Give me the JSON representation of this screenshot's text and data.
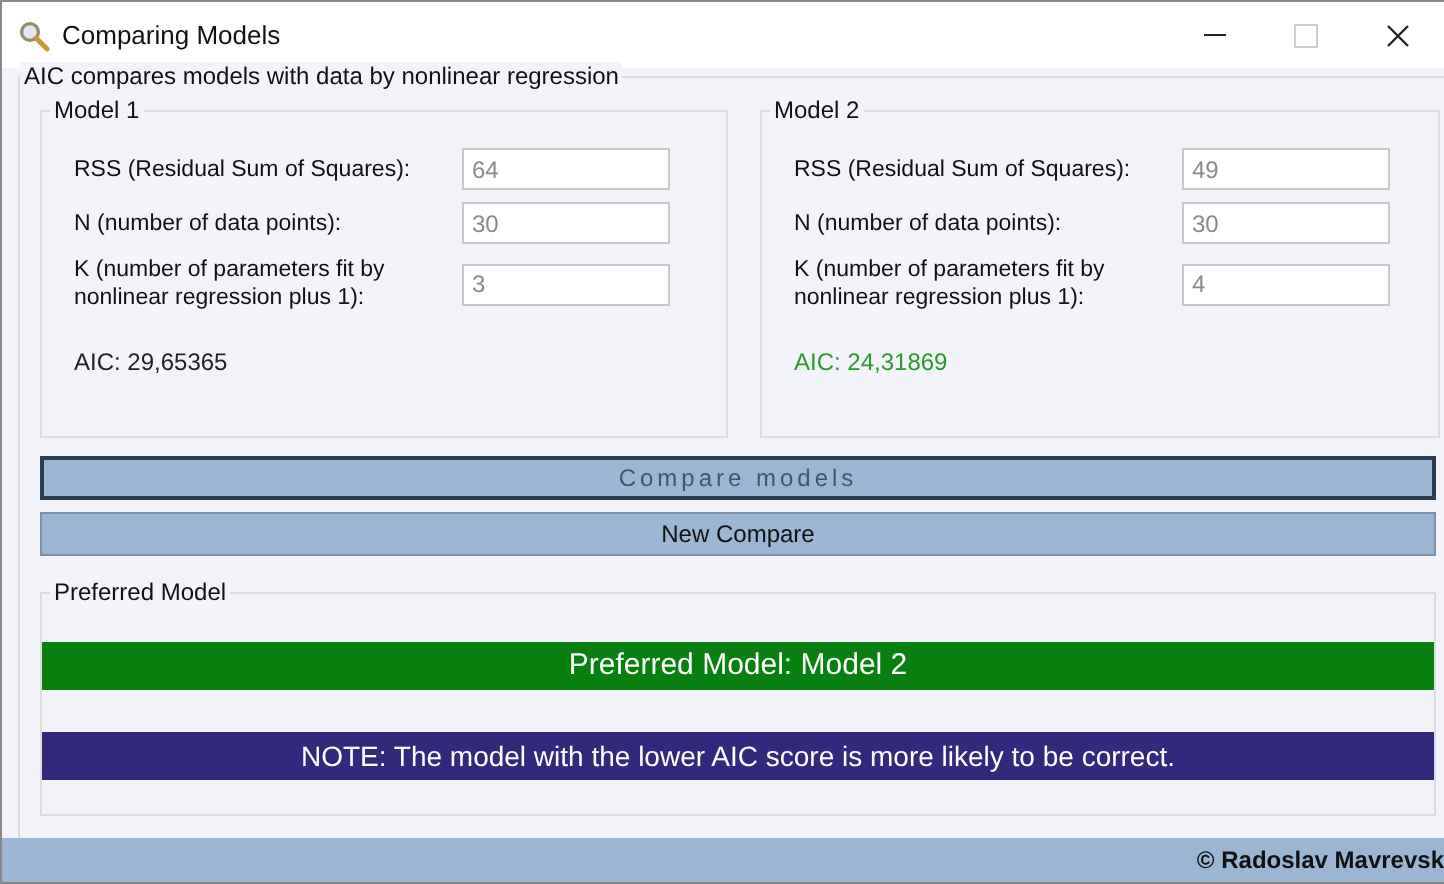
{
  "window": {
    "title": "Comparing Models"
  },
  "main_group": {
    "title": "AIC compares models with data by nonlinear regression"
  },
  "models": [
    {
      "title": "Model 1",
      "fields": [
        {
          "label": "RSS (Residual Sum of Squares):",
          "value": "64",
          "disabled": true
        },
        {
          "label": "N (number of data points):",
          "value": "30",
          "disabled": true
        },
        {
          "label": "K (number of parameters fit by nonlinear regression plus 1):",
          "value": "3",
          "disabled": true
        }
      ],
      "aic": "AIC: 29,65365",
      "preferred": false
    },
    {
      "title": "Model 2",
      "fields": [
        {
          "label": "RSS (Residual Sum of Squares):",
          "value": "49",
          "disabled": true
        },
        {
          "label": "N (number of data points):",
          "value": "30",
          "disabled": true
        },
        {
          "label": "K (number of parameters fit by nonlinear regression plus 1):",
          "value": "4",
          "disabled": true
        }
      ],
      "aic": "AIC: 24,31869",
      "preferred": true
    }
  ],
  "buttons": [
    {
      "label": "Compare models",
      "disabled": true,
      "focused": true
    },
    {
      "label": "New Compare",
      "disabled": false,
      "focused": false
    }
  ],
  "result_group": {
    "title": "Preferred Model",
    "result": "Preferred Model: Model 2",
    "note": "NOTE: The model with the lower AIC score is more likely to be correct."
  },
  "status_bar": {
    "text": "© Radoslav Mavrevsk"
  }
}
